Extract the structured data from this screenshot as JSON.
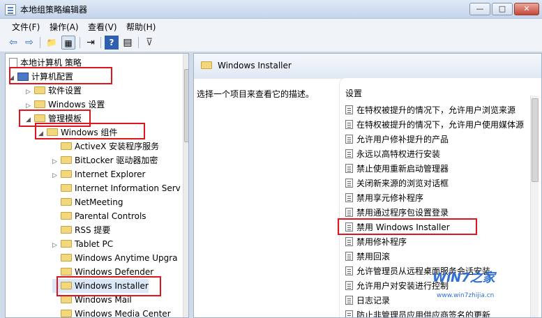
{
  "window": {
    "title": "本地组策略编辑器",
    "min": "—",
    "max": "□",
    "close": "✕"
  },
  "menu": [
    "文件(F)",
    "操作(A)",
    "查看(V)",
    "帮助(H)"
  ],
  "toolbar": {
    "back": "⇦",
    "forward": "⇨",
    "up": "📁",
    "show_hide": "▦",
    "export": "⇥",
    "help": "?",
    "props": "▤",
    "filter": "⊽"
  },
  "tree": {
    "root": "本地计算机 策略",
    "computer_config": "计算机配置",
    "software_settings": "软件设置",
    "windows_settings": "Windows 设置",
    "admin_templates": "管理模板",
    "windows_components": "Windows 组件",
    "items": [
      "ActiveX 安装程序服务",
      "BitLocker 驱动器加密",
      "Internet Explorer",
      "Internet Information Serv",
      "NetMeeting",
      "Parental Controls",
      "RSS 提要",
      "Tablet PC",
      "Windows Anytime Upgra",
      "Windows Defender",
      "Windows Installer",
      "Windows Mail",
      "Windows Media Center"
    ]
  },
  "right": {
    "title": "Windows Installer",
    "description": "选择一个项目来查看它的描述。",
    "column": "设置",
    "settings": [
      "在特权被提升的情况下，允许用户浏览来源",
      "在特权被提升的情况下，允许用户使用媒体源",
      "允许用户修补提升的产品",
      "永远以高特权进行安装",
      "禁止使用重新启动管理器",
      "关闭新来源的浏览对话框",
      "禁用享元修补程序",
      "禁用通过程序包设置登录",
      "禁用 Windows Installer",
      "禁用修补程序",
      "禁用回滚",
      "允许管理员从远程桌面服务会话安装",
      "允许用户对安装进行控制",
      "日志记录",
      "防止非管理员应用供应商签名的更新"
    ]
  },
  "watermark": {
    "text": "WiN7之家",
    "url": "www.win7zhijia.cn"
  },
  "colors": {
    "highlight": "#e0141e",
    "watermark": "#2d6fd6"
  }
}
